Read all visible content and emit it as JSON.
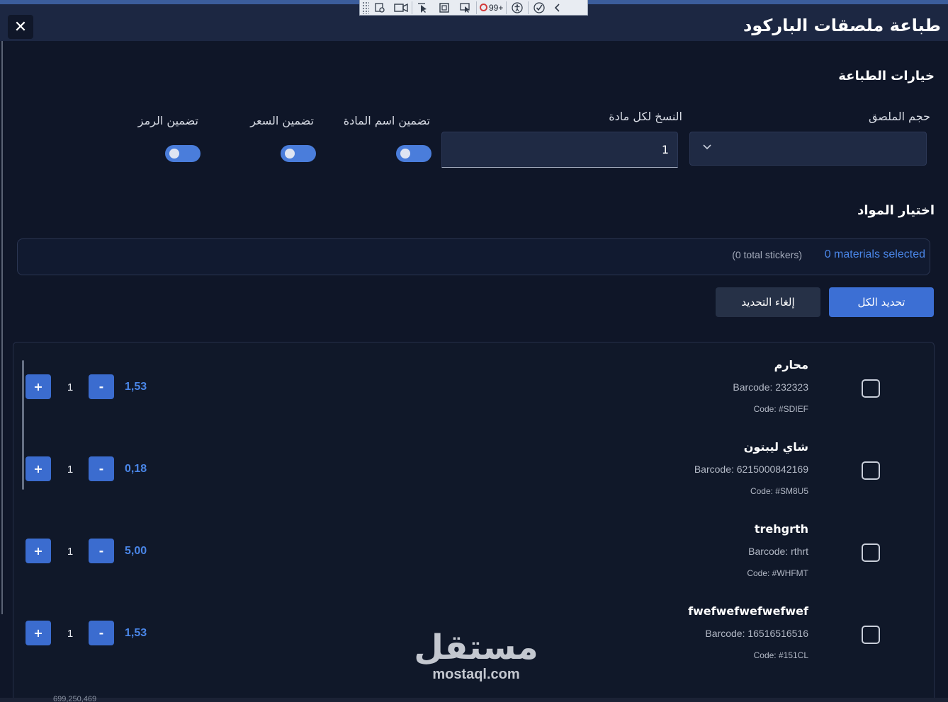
{
  "debug_toolbar": {
    "counter": "99+"
  },
  "header": {
    "title": "طباعة ملصقات الباركود",
    "close_label": "✕"
  },
  "print_options": {
    "section_title": "خيارات الطباعة",
    "sticker_size_label": "حجم الملصق",
    "sticker_size_value": "",
    "copies_label": "النسخ لكل مادة",
    "copies_value": "1",
    "toggles": [
      {
        "label": "تضمين اسم المادة",
        "on": true
      },
      {
        "label": "تضمين السعر",
        "on": true
      },
      {
        "label": "تضمين الرمز",
        "on": true
      }
    ]
  },
  "materials": {
    "section_title": "اختيار المواد",
    "selected_count": "0 materials selected",
    "total_stickers": "(0 total stickers)",
    "select_all_label": "تحديد الكل",
    "deselect_label": "إلغاء التحديد",
    "items": [
      {
        "name": "محارم",
        "barcode": "Barcode: 232323",
        "code": "Code: #SDIEF",
        "price": "1,53",
        "qty": "1",
        "checked": false
      },
      {
        "name": "شاي ليبتون",
        "barcode": "Barcode: 6215000842169",
        "code": "Code: #SM8U5",
        "price": "0,18",
        "qty": "1",
        "checked": false
      },
      {
        "name": "trehgrth",
        "barcode": "Barcode: rthrt",
        "code": "Code: #WHFMT",
        "price": "5,00",
        "qty": "1",
        "checked": false
      },
      {
        "name": "fwefwefwefwefwef",
        "barcode": "Barcode: 16516516516",
        "code": "Code: #151CL",
        "price": "1,53",
        "qty": "1",
        "checked": false
      }
    ],
    "plus_label": "+",
    "minus_label": "-"
  },
  "watermark": {
    "arabic": "مستقل",
    "latin": "mostaql.com"
  },
  "footer": {
    "partial_text": "699,250,469"
  },
  "colors": {
    "background": "#0f1628",
    "header": "#1c2742",
    "accent": "#3c6fd4",
    "link": "#4a86e8"
  }
}
